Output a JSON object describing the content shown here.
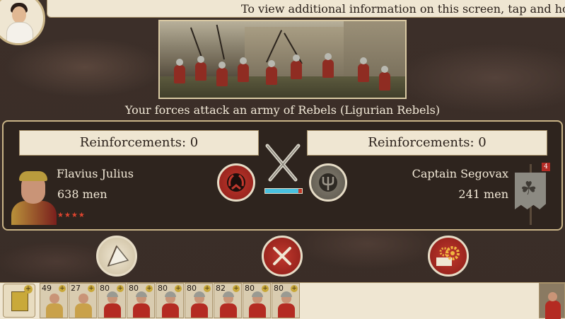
{
  "header": {
    "info_text": "To view additional information on this screen, tap and hold a"
  },
  "battle": {
    "caption": "Your forces attack an army of Rebels (Ligurian Rebels)",
    "strength_balance": 0.9
  },
  "player": {
    "reinforcements_label": "Reinforcements: 0",
    "commander": "Flavius Julius",
    "men": "638 men",
    "rank_stars": "★★★★"
  },
  "enemy": {
    "reinforcements_label": "Reinforcements: 0",
    "commander": "Captain Segovax",
    "men": "241 men",
    "tag": "4"
  },
  "icons": {
    "player_emblem": "laurel-wreath-icon",
    "enemy_emblem": "trident-icon",
    "retreat": "white-flag-icon",
    "fight": "crossed-swords-icon",
    "autoresolve": "gears-icon"
  },
  "colors": {
    "rome_red": "#c0382d",
    "rebel_grey": "#6e685c",
    "balance_player": "#49c1e0",
    "balance_enemy": "#c03a2a"
  },
  "units": [
    {
      "count": "49",
      "type": "general"
    },
    {
      "count": "27",
      "type": "general"
    },
    {
      "count": "80",
      "type": "infantry"
    },
    {
      "count": "80",
      "type": "infantry"
    },
    {
      "count": "80",
      "type": "infantry"
    },
    {
      "count": "80",
      "type": "infantry"
    },
    {
      "count": "82",
      "type": "infantry"
    },
    {
      "count": "80",
      "type": "infantry"
    },
    {
      "count": "80",
      "type": "infantry"
    }
  ]
}
